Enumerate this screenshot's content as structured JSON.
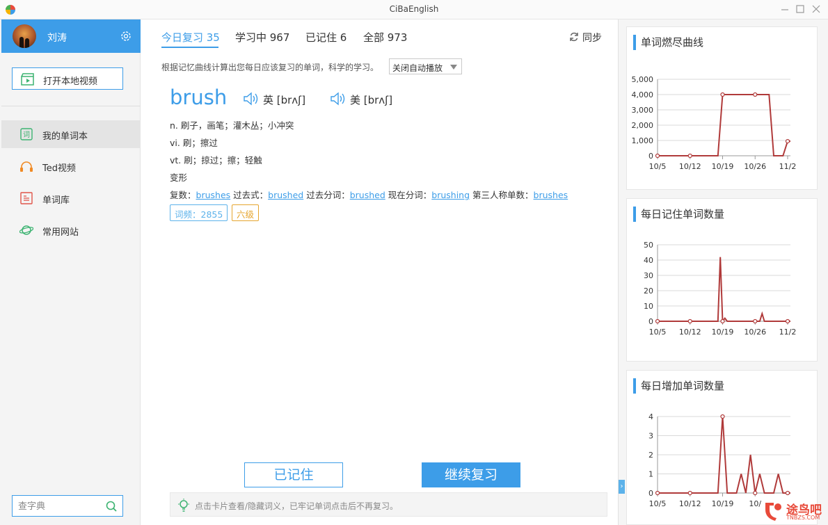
{
  "window": {
    "title": "CiBaEnglish"
  },
  "user": {
    "name": "刘涛"
  },
  "sidebar": {
    "open_video_label": "打开本地视频",
    "items": [
      {
        "label": "我的单词本",
        "icon": "wordbook-icon",
        "active": true
      },
      {
        "label": "Ted视频",
        "icon": "headphones-icon",
        "active": false
      },
      {
        "label": "单词库",
        "icon": "word-library-icon",
        "active": false
      },
      {
        "label": "常用网站",
        "icon": "planet-icon",
        "active": false
      }
    ],
    "dict_placeholder": "查字典"
  },
  "tabs": [
    {
      "label": "今日复习 35",
      "active": true
    },
    {
      "label": "学习中 967",
      "active": false
    },
    {
      "label": "已记住 6",
      "active": false
    },
    {
      "label": "全部 973",
      "active": false
    }
  ],
  "sync_label": "同步",
  "hint": "根据记忆曲线计算出您每日应该复习的单词，科学的学习。",
  "autoplay_option": "关闭自动播放",
  "word": {
    "text": "brush",
    "uk": "英 [brʌʃ]",
    "us": "美 [brʌʃ]",
    "definitions": [
      "n.  刷子，画笔；灌木丛；小冲突",
      "vi.  刷；擦过",
      "vt.  刷；掠过；擦；轻触",
      "变形"
    ],
    "forms": [
      {
        "label": "复数：",
        "value": "brushes"
      },
      {
        "label": "过去式：",
        "value": "brushed"
      },
      {
        "label": "过去分词：",
        "value": "brushed"
      },
      {
        "label": "现在分词：",
        "value": "brushing"
      },
      {
        "label": "第三人称单数：",
        "value": "brushes"
      }
    ],
    "frequency": "词频：2855",
    "level": "六级"
  },
  "actions": {
    "remember": "已记住",
    "continue": "继续复习"
  },
  "tip": "点击卡片查看/隐藏词义，已牢记单词点击后不再复习。",
  "colors": {
    "accent": "#3d9de8",
    "line": "#b03a3a",
    "level": "#e6a52e"
  },
  "chart_data": [
    {
      "type": "line",
      "title": "单词燃尽曲线",
      "x": [
        "10/5",
        "10/12",
        "10/19",
        "10/26",
        "11/2"
      ],
      "x_tick_labels": [
        "10/5",
        "10/12",
        "10/19",
        "10/26",
        "11/2"
      ],
      "points": [
        [
          0,
          0
        ],
        [
          7,
          0
        ],
        [
          13,
          0
        ],
        [
          14,
          4000
        ],
        [
          21,
          4000
        ],
        [
          24,
          4000
        ],
        [
          25,
          0
        ],
        [
          27,
          0
        ],
        [
          28,
          950
        ],
        [
          28.6,
          950
        ]
      ],
      "markers": [
        [
          0,
          0
        ],
        [
          7,
          0
        ],
        [
          14,
          4000
        ],
        [
          21,
          4000
        ],
        [
          28,
          950
        ]
      ],
      "y_ticks": [
        "0",
        "1,000",
        "2,000",
        "3,000",
        "4,000",
        "5,000"
      ],
      "ylim": [
        0,
        5000
      ],
      "xlim": [
        0,
        28.6
      ],
      "grid": true
    },
    {
      "type": "line",
      "title": "每日记住单词数量",
      "x_tick_labels": [
        "10/5",
        "10/12",
        "10/19",
        "10/26",
        "11/2"
      ],
      "points": [
        [
          0,
          0
        ],
        [
          7,
          0
        ],
        [
          13,
          0
        ],
        [
          13.5,
          42
        ],
        [
          14,
          0
        ],
        [
          14.5,
          2
        ],
        [
          15,
          0
        ],
        [
          22,
          0
        ],
        [
          22.5,
          5
        ],
        [
          23,
          0
        ],
        [
          28,
          0
        ],
        [
          28.6,
          0
        ]
      ],
      "markers": [
        [
          0,
          0
        ],
        [
          7,
          0
        ],
        [
          14,
          0
        ],
        [
          21,
          0
        ],
        [
          28,
          0
        ]
      ],
      "y_ticks": [
        "0",
        "10",
        "20",
        "30",
        "40",
        "50"
      ],
      "ylim": [
        0,
        50
      ],
      "xlim": [
        0,
        28.6
      ],
      "grid": true
    },
    {
      "type": "line",
      "title": "每日增加单词数量",
      "x_tick_labels": [
        "10/5",
        "10/12",
        "10/19",
        "10/"
      ],
      "points": [
        [
          0,
          0
        ],
        [
          7,
          0
        ],
        [
          13,
          0
        ],
        [
          14,
          4
        ],
        [
          15,
          0
        ],
        [
          17,
          0
        ],
        [
          18,
          1
        ],
        [
          19,
          0
        ],
        [
          20,
          2
        ],
        [
          21,
          0
        ],
        [
          22,
          1
        ],
        [
          23,
          0
        ],
        [
          25,
          0
        ],
        [
          26,
          1
        ],
        [
          27,
          0
        ],
        [
          28.6,
          0
        ]
      ],
      "markers": [
        [
          0,
          0
        ],
        [
          7,
          0
        ],
        [
          14,
          4
        ],
        [
          21,
          0
        ],
        [
          28,
          0
        ]
      ],
      "y_ticks": [
        "0",
        "1",
        "2",
        "3",
        "4"
      ],
      "ylim": [
        0,
        4.4
      ],
      "xlim": [
        0,
        28.6
      ],
      "grid": true
    }
  ],
  "watermark": {
    "brand": "途鸟吧",
    "url": "TNBZS.COM"
  }
}
